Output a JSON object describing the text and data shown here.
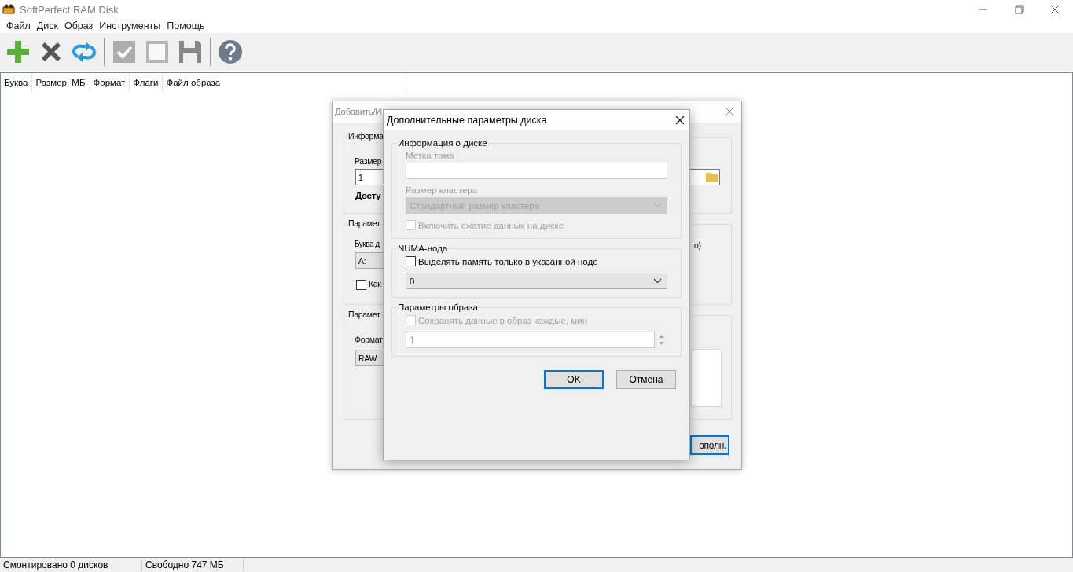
{
  "window": {
    "title": "SoftPerfect RAM Disk"
  },
  "menu": [
    "Файл",
    "Диск",
    "Образ",
    "Инструменты",
    "Помощь"
  ],
  "toolbar": [
    {
      "kind": "add",
      "disabled": false
    },
    {
      "kind": "remove",
      "disabled": false
    },
    {
      "kind": "refresh",
      "disabled": false
    },
    {
      "kind": "separator"
    },
    {
      "kind": "check",
      "disabled": true
    },
    {
      "kind": "square",
      "disabled": true
    },
    {
      "kind": "save",
      "disabled": true
    },
    {
      "kind": "separator"
    },
    {
      "kind": "help",
      "disabled": false
    }
  ],
  "disk_list": {
    "columns": [
      "Буква",
      "Размер, МБ",
      "Формат",
      "Флаги",
      "Файл образа"
    ]
  },
  "status_bar": [
    "Смонтировано 0 дисков",
    "Свободно 747 МБ"
  ],
  "background_dialog": {
    "title": "Добавить/И",
    "group_1": "Информа",
    "size_label": "Размер",
    "size_value": "1",
    "available": "Досту",
    "group_2": "Парамет",
    "letter_label": "Буква д",
    "letter_value": "A:",
    "checkbox_label": "Как",
    "checked": false,
    "column_3_text": "о)",
    "group_3": "Парамет",
    "format_label": "Формат",
    "format_value": "RAW",
    "button": "ополн."
  },
  "dialog": {
    "title": "Дополнительные параметры диска",
    "groups": [
      {
        "title": "Информация о диске",
        "items": [
          {
            "kind": "field",
            "label": "Метка тома",
            "disabled": true
          },
          {
            "kind": "select",
            "label": "Размер кластера",
            "value": "Стандартный размер кластера",
            "disabled": true
          },
          {
            "kind": "checkbox",
            "label": "Включить сжатие данных на диске",
            "checked": false,
            "disabled": true
          }
        ]
      },
      {
        "title": "NUMA-нода",
        "items": [
          {
            "kind": "checkbox",
            "label": "Выделять память только в указанной ноде",
            "checked": false,
            "disabled": false
          },
          {
            "kind": "select",
            "value": "0",
            "disabled": false
          }
        ]
      },
      {
        "title": "Параметры образа",
        "items": [
          {
            "kind": "checkbox",
            "label": "Сохранять данные в образ каждые, мин",
            "checked": false,
            "disabled": true
          },
          {
            "kind": "spin",
            "value": "1",
            "disabled": true
          }
        ]
      }
    ],
    "buttons": [
      {
        "label": "OK",
        "default": true
      },
      {
        "label": "Отмена",
        "default": false
      }
    ]
  }
}
